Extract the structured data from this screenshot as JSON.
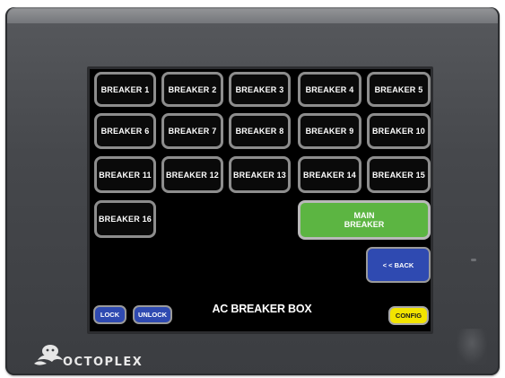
{
  "screen": {
    "title": "AC BREAKER BOX",
    "breakers": [
      "BREAKER 1",
      "BREAKER 2",
      "BREAKER 3",
      "BREAKER 4",
      "BREAKER 5",
      "BREAKER 6",
      "BREAKER 7",
      "BREAKER 8",
      "BREAKER 9",
      "BREAKER 10",
      "BREAKER 11",
      "BREAKER 12",
      "BREAKER 13",
      "BREAKER 14",
      "BREAKER 15",
      "BREAKER 16"
    ],
    "main_breaker_label": "MAIN\nBREAKER",
    "back_label": "< < BACK",
    "lock_label": "LOCK",
    "unlock_label": "UNLOCK",
    "config_label": "CONFIG"
  },
  "brand": {
    "logo_text": "OCTOPLEX",
    "logo_icon": "octopus-icon"
  },
  "colors": {
    "main_breaker": "#5cb542",
    "back": "#2f4ab1",
    "lock": "#2f4ab1",
    "config": "#f2e400"
  }
}
